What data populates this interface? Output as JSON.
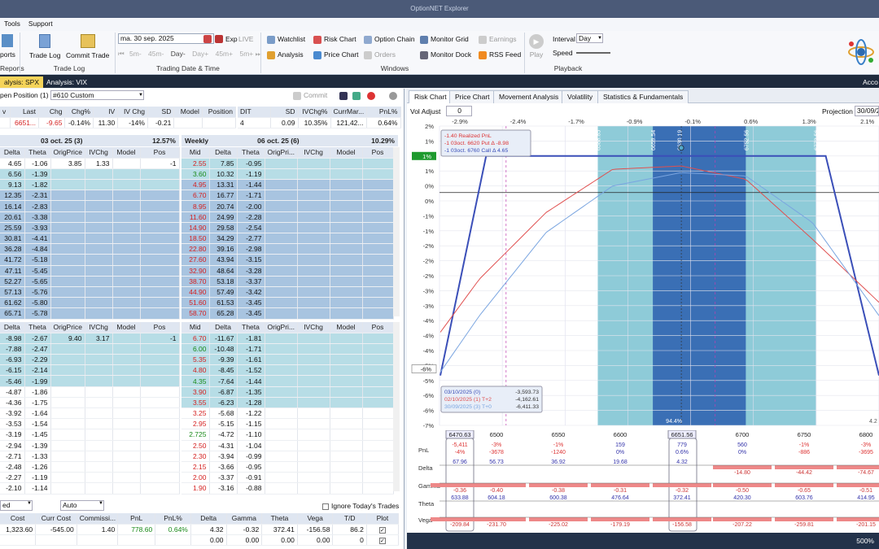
{
  "app": {
    "title": "OptionNET Explorer"
  },
  "menu": [
    "Tools",
    "Support"
  ],
  "ribbon": {
    "reports": [
      "ports",
      "Reports"
    ],
    "trade": {
      "trade_log": "Trade Log",
      "commit_trade": "Commit Trade",
      "group": "Trade Log"
    },
    "date": {
      "value": "ma. 30 sep. 2025",
      "exp": "Exp",
      "live": "LIVE",
      "steps": [
        "5m-",
        "45m-",
        "Day-",
        "Day+",
        "45m+",
        "5m+"
      ],
      "group": "Trading Date & Time"
    },
    "windows": {
      "watchlist": "Watchlist",
      "risk_chart": "Risk Chart",
      "option_chain": "Option Chain",
      "monitor_grid": "Monitor Grid",
      "earnings": "Earnings",
      "analysis": "Analysis",
      "price_chart": "Price Chart",
      "orders": "Orders",
      "monitor_dock": "Monitor Dock",
      "rss": "RSS Feed",
      "group": "Windows"
    },
    "playback": {
      "play": "Play",
      "interval_label": "Interval",
      "interval": "Day",
      "speed": "Speed",
      "group": "Playback"
    }
  },
  "doc_tabs": [
    "alysis: SPX",
    "Analysis: VIX",
    "Acco"
  ],
  "left": {
    "position_label": "pen Position (1)",
    "position_select": "#610 Custom",
    "commit": "Commit",
    "summary_headers": [
      "v",
      "Last",
      "Chg",
      "Chg%",
      "IV",
      "IV Chg",
      "SD",
      "Model",
      "Position"
    ],
    "summary_values": [
      "",
      "6651...",
      "-9.65",
      "-0.14%",
      "11.30",
      "-14%",
      "-0.21",
      "",
      ""
    ],
    "summary2_headers": [
      "DIT",
      "SD",
      "IVChg%",
      "CurrMar...",
      "PnL%"
    ],
    "summary2_values": [
      "4",
      "0.09",
      "10.35%",
      "121,42...",
      "0.64%"
    ],
    "exp1": {
      "title": "03 oct. 25 (3)",
      "pct": "12.57%"
    },
    "exp2": {
      "label": "Weekly",
      "title": "06 oct. 25 (6)",
      "pct": "10.29%"
    },
    "calls_headers_l": [
      "Delta",
      "Theta",
      "OrigPrice",
      "IVChg",
      "Model",
      "Pos"
    ],
    "calls_l": [
      [
        "4.65",
        "-1.06",
        "3.85",
        "1.33",
        "",
        "-1"
      ],
      [
        "6.56",
        "-1.39",
        "",
        "",
        "",
        ""
      ],
      [
        "9.13",
        "-1.82",
        "",
        "",
        "",
        ""
      ],
      [
        "12.35",
        "-2.31",
        "",
        "",
        "",
        ""
      ],
      [
        "16.14",
        "-2.83",
        "",
        "",
        "",
        ""
      ],
      [
        "20.61",
        "-3.38",
        "",
        "",
        "",
        ""
      ],
      [
        "25.59",
        "-3.93",
        "",
        "",
        "",
        ""
      ],
      [
        "30.81",
        "-4.41",
        "",
        "",
        "",
        ""
      ],
      [
        "36.28",
        "-4.84",
        "",
        "",
        "",
        ""
      ],
      [
        "41.72",
        "-5.18",
        "",
        "",
        "",
        ""
      ],
      [
        "47.11",
        "-5.45",
        "",
        "",
        "",
        ""
      ],
      [
        "52.27",
        "-5.65",
        "",
        "",
        "",
        ""
      ],
      [
        "57.13",
        "-5.76",
        "",
        "",
        "",
        ""
      ],
      [
        "61.62",
        "-5.80",
        "",
        "",
        "",
        ""
      ],
      [
        "65.71",
        "-5.78",
        "",
        "",
        "",
        ""
      ]
    ],
    "calls_headers_r": [
      "Mid",
      "Delta",
      "Theta",
      "OrigPri...",
      "IVChg",
      "Model",
      "Pos"
    ],
    "calls_r": [
      [
        "2.55",
        "7.85",
        "-0.95"
      ],
      [
        "3.60",
        "10.32",
        "-1.19"
      ],
      [
        "4.95",
        "13.31",
        "-1.44"
      ],
      [
        "6.70",
        "16.77",
        "-1.71"
      ],
      [
        "8.95",
        "20.74",
        "-2.00"
      ],
      [
        "11.60",
        "24.99",
        "-2.28"
      ],
      [
        "14.90",
        "29.58",
        "-2.54"
      ],
      [
        "18.50",
        "34.29",
        "-2.77"
      ],
      [
        "22.80",
        "39.16",
        "-2.98"
      ],
      [
        "27.60",
        "43.94",
        "-3.15"
      ],
      [
        "32.90",
        "48.64",
        "-3.28"
      ],
      [
        "38.70",
        "53.18",
        "-3.37"
      ],
      [
        "44.90",
        "57.49",
        "-3.42"
      ],
      [
        "51.60",
        "61.53",
        "-3.45"
      ],
      [
        "58.70",
        "65.28",
        "-3.45"
      ]
    ],
    "puts_l": [
      [
        "-8.98",
        "-2.67",
        "9.40",
        "3.17",
        "",
        "-1"
      ],
      [
        "-7.88",
        "-2.47",
        "",
        "",
        "",
        ""
      ],
      [
        "-6.93",
        "-2.29",
        "",
        "",
        "",
        ""
      ],
      [
        "-6.15",
        "-2.14",
        "",
        "",
        "",
        ""
      ],
      [
        "-5.46",
        "-1.99",
        "",
        "",
        "",
        ""
      ],
      [
        "-4.87",
        "-1.86",
        "",
        "",
        "",
        ""
      ],
      [
        "-4.36",
        "-1.75",
        "",
        "",
        "",
        ""
      ],
      [
        "-3.92",
        "-1.64",
        "",
        "",
        "",
        ""
      ],
      [
        "-3.53",
        "-1.54",
        "",
        "",
        "",
        ""
      ],
      [
        "-3.19",
        "-1.45",
        "",
        "",
        "",
        ""
      ],
      [
        "-2.94",
        "-1.39",
        "",
        "",
        "",
        ""
      ],
      [
        "-2.71",
        "-1.33",
        "",
        "",
        "",
        ""
      ],
      [
        "-2.48",
        "-1.26",
        "",
        "",
        "",
        ""
      ],
      [
        "-2.27",
        "-1.19",
        "",
        "",
        "",
        ""
      ],
      [
        "-2.10",
        "-1.14",
        "",
        "",
        "",
        ""
      ]
    ],
    "puts_r": [
      [
        "6.70",
        "-11.67",
        "-1.81"
      ],
      [
        "6.00",
        "-10.48",
        "-1.71"
      ],
      [
        "5.35",
        "-9.39",
        "-1.61"
      ],
      [
        "4.80",
        "-8.45",
        "-1.52"
      ],
      [
        "4.35",
        "-7.64",
        "-1.44"
      ],
      [
        "3.90",
        "-6.87",
        "-1.35"
      ],
      [
        "3.55",
        "-6.23",
        "-1.28"
      ],
      [
        "3.25",
        "-5.68",
        "-1.22"
      ],
      [
        "2.95",
        "-5.15",
        "-1.15"
      ],
      [
        "2.725",
        "-4.72",
        "-1.10"
      ],
      [
        "2.50",
        "-4.31",
        "-1.04"
      ],
      [
        "2.30",
        "-3.94",
        "-0.99"
      ],
      [
        "2.15",
        "-3.66",
        "-0.95"
      ],
      [
        "2.00",
        "-3.37",
        "-0.91"
      ],
      [
        "1.90",
        "-3.16",
        "-0.88"
      ]
    ],
    "bottom": {
      "sel1": "ed",
      "sel2": "Auto",
      "ignore": "Ignore Today's Trades",
      "headers": [
        "Cost",
        "Curr Cost",
        "Commissi...",
        "PnL",
        "PnL%",
        "Delta",
        "Gamma",
        "Theta",
        "Vega",
        "T/D",
        "Plot"
      ],
      "row1": [
        "1,323.60",
        "-545.00",
        "1.40",
        "778.60",
        "0.64%",
        "4.32",
        "-0.32",
        "372.41",
        "-156.58",
        "86.2",
        ""
      ],
      "row2": [
        "",
        "",
        "",
        "",
        "",
        "0.00",
        "0.00",
        "0.00",
        "0.00",
        "0",
        ""
      ]
    }
  },
  "right": {
    "tabs": [
      "Risk Chart",
      "Price Chart",
      "Movement Analysis",
      "Volatility",
      "Statistics & Fundamentals"
    ],
    "vol_adjust": "Vol Adjust",
    "vol_value": "0",
    "projection": "Projection",
    "projection_date": "30/09/2",
    "top_pct": [
      "-2.9%",
      "-2.4%",
      "-1.7%",
      "-0.9%",
      "-0.1%",
      "0.6%",
      "1.3%",
      "2.1%"
    ],
    "y_ticks": [
      "2%",
      "1%",
      "1%",
      "1%",
      "0%",
      "0%",
      "-1%",
      "-1%",
      "-2%",
      "-2%",
      "-2%",
      "-3%",
      "-3%",
      "-4%",
      "-4%",
      "-4%",
      "-5%",
      "-5%",
      "-6%",
      "-6%",
      "-7%"
    ],
    "y_badge": "1%",
    "y_badge2": "-6%",
    "legend1": [
      "-1.40 Realized PnL",
      "-1 03oct. 6620 Put Δ   -8.98",
      "-1 03oct. 6760 Call Δ   4.65"
    ],
    "legend2": [
      [
        "03/10/2025 (0)",
        "-3,593.73"
      ],
      [
        "02/10/2025 (1) T+2",
        "-4,162.61"
      ],
      [
        "30/09/2025 (3) T+0",
        "-6,411.33"
      ]
    ],
    "x_ticks": [
      "6470.63",
      "6500",
      "6550",
      "6600",
      "6651.56",
      "6700",
      "6750",
      "6800"
    ],
    "vert_labels": [
      "6588.85",
      "6659.54",
      "6630.19",
      "6752.56",
      "6772.56"
    ],
    "prob": "94.4%",
    "prob2": "4.2",
    "greeks": {
      "rows": [
        "PnL",
        "Delta",
        "Gamma",
        "Theta",
        "Vega"
      ],
      "pnl": [
        "-5,411",
        "-4%",
        "-3%",
        "-3678",
        "-1%",
        "-1240",
        "159",
        "0%",
        "779",
        "0.6%",
        "560",
        "0%",
        "-1%",
        "-886",
        "-3%",
        "-3695"
      ],
      "delta": [
        "67.96",
        "56.73",
        "36.92",
        "19.68",
        "4.32",
        "-14.80",
        "-44.42",
        "-74.67"
      ],
      "gamma": [
        "-0.36",
        "-0.40",
        "-0.38",
        "-0.31",
        "-0.32",
        "-0.50",
        "-0.65",
        "-0.51"
      ],
      "theta": [
        "633.88",
        "604.18",
        "600.38",
        "476.64",
        "372.41",
        "420.30",
        "603.76",
        "414.95"
      ],
      "vega": [
        "-209.84",
        "-231.70",
        "-225.02",
        "-179.19",
        "-156.58",
        "-207.22",
        "-259.81",
        "-201.15"
      ]
    },
    "zoom": "500%"
  },
  "chart_data": {
    "type": "line",
    "xlabel": "",
    "ylabel": "",
    "x": [
      6470.63,
      6500,
      6550,
      6600,
      6651.56,
      6700,
      6750,
      6800
    ],
    "series": [
      {
        "name": "03/10/2025 (0)",
        "values": [
          -5.5,
          -3.5,
          1.1,
          1.1,
          1.1,
          1.1,
          -3.0,
          -5.5
        ]
      },
      {
        "name": "02/10/2025 (1) T+2",
        "values": [
          -4.2,
          -2.6,
          -0.6,
          0.7,
          0.8,
          0.4,
          -1.4,
          -3.3
        ]
      },
      {
        "name": "30/09/2025 (3) T+0",
        "values": [
          -5.4,
          -3.7,
          -1.2,
          0.2,
          0.6,
          0.5,
          -0.9,
          -3.7
        ]
      }
    ],
    "xlim": [
      6470,
      6800
    ],
    "ylim": [
      -7,
      2
    ]
  }
}
